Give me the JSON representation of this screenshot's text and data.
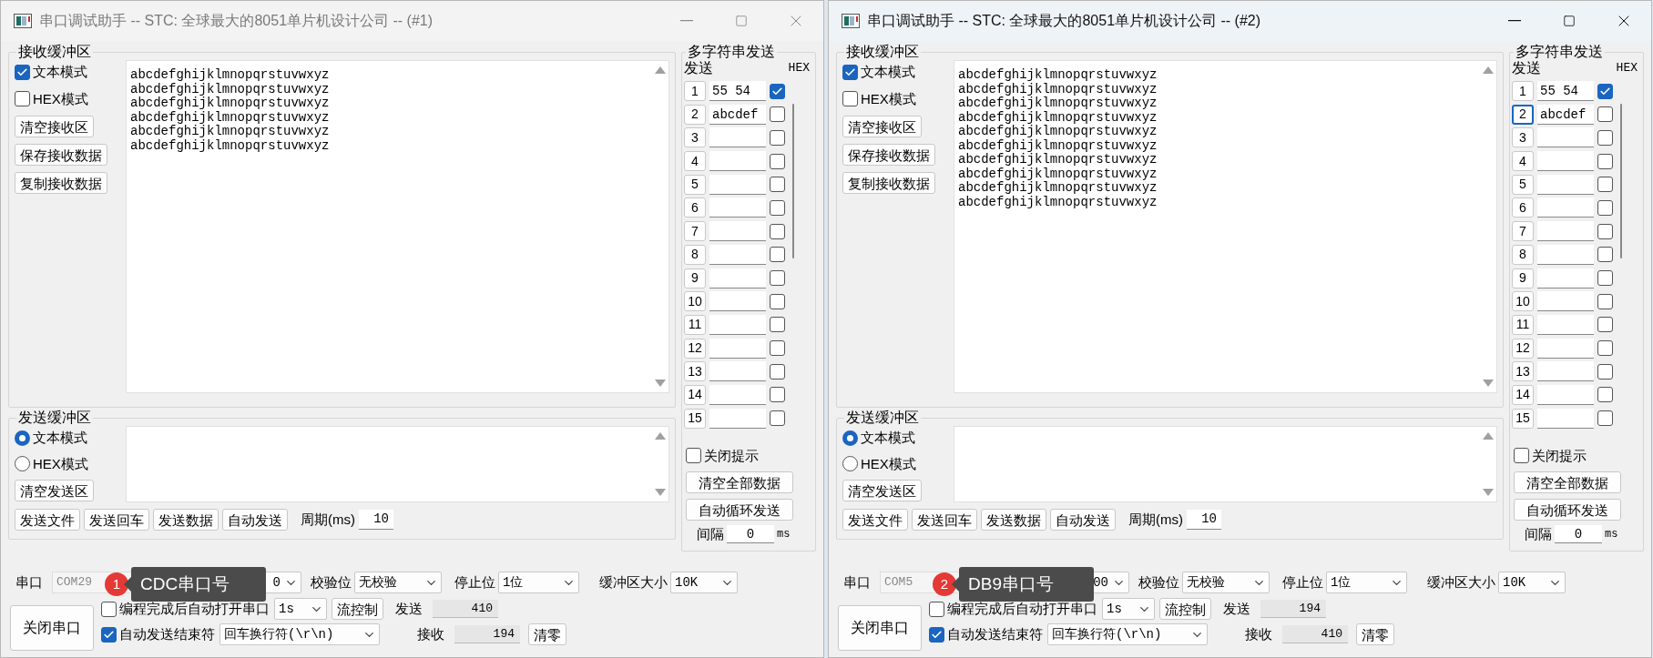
{
  "windows": [
    {
      "title": "串口调试助手 -- STC: 全球最大的8051单片机设计公司 -- (#1)",
      "active": false,
      "receive": {
        "label": "接收缓冲区",
        "modes": [
          {
            "label": "文本模式",
            "checked": true
          },
          {
            "label": "HEX模式",
            "checked": false
          }
        ],
        "buttons": [
          "清空接收区",
          "保存接收数据",
          "复制接收数据"
        ],
        "lines": [
          "abcdefghijklmnopqrstuvwxyz",
          "abcdefghijklmnopqrstuvwxyz",
          "abcdefghijklmnopqrstuvwxyz",
          "abcdefghijklmnopqrstuvwxyz",
          "abcdefghijklmnopqrstuvwxyz",
          "abcdefghijklmnopqrstuvwxyz"
        ]
      },
      "send": {
        "label": "发送缓冲区",
        "modes": [
          {
            "label": "文本模式",
            "selected": true
          },
          {
            "label": "HEX模式",
            "selected": false
          }
        ],
        "clear_button": "清空发送区",
        "buttons": [
          "发送文件",
          "发送回车",
          "发送数据",
          "自动发送"
        ],
        "period_label": "周期(ms)",
        "period": "10"
      },
      "multi_send": {
        "label": "多字符串发送",
        "send_header": "发送",
        "hex_header": "HEX",
        "rows": [
          {
            "number": "1",
            "value": "55 54",
            "hex": true,
            "focused": false
          },
          {
            "number": "2",
            "value": "abcdef",
            "hex": false,
            "focused": false
          },
          {
            "number": "3",
            "hex": false,
            "focused": false
          },
          {
            "number": "4",
            "hex": false,
            "focused": false
          },
          {
            "number": "5",
            "hex": false,
            "focused": false
          },
          {
            "number": "6",
            "hex": false,
            "focused": false
          },
          {
            "number": "7",
            "hex": false,
            "focused": false
          },
          {
            "number": "8",
            "hex": false,
            "focused": false
          },
          {
            "number": "9",
            "hex": false,
            "focused": false
          },
          {
            "number": "10",
            "hex": false,
            "focused": false
          },
          {
            "number": "11",
            "hex": false,
            "focused": false
          },
          {
            "number": "12",
            "hex": false,
            "focused": false
          },
          {
            "number": "13",
            "hex": false,
            "focused": false
          },
          {
            "number": "14",
            "hex": false,
            "focused": false
          },
          {
            "number": "15",
            "hex": false,
            "focused": false
          }
        ],
        "close_hint": {
          "label": "关闭提示",
          "checked": false
        },
        "buttons": [
          "清空全部数据",
          "自动循环发送"
        ],
        "interval_label": "间隔",
        "interval": "0",
        "interval_unit": "ms"
      },
      "port_bar": {
        "port_label": "串口",
        "port": "COM29",
        "baud": "0",
        "parity_label": "校验位",
        "parity": "无校验",
        "stop_label": "停止位",
        "stop": "1位",
        "buffer_label": "缓冲区大小",
        "buffer": "10K",
        "close_button": "关闭串口",
        "auto_open": {
          "label": "编程完成后自动打开串口",
          "checked": false
        },
        "auto_open_delay": "1s",
        "flow_button": "流控制",
        "auto_end": {
          "label": "自动发送结束符",
          "checked": true
        },
        "end_char": "回车换行符(\\r\\n)",
        "sent_label": "发送",
        "sent": "410",
        "received_label": "接收",
        "received": "194",
        "zero_button": "清零"
      },
      "tooltip": {
        "badge": "1",
        "text": "CDC串口号"
      }
    },
    {
      "title": "串口调试助手 -- STC: 全球最大的8051单片机设计公司 -- (#2)",
      "active": true,
      "receive": {
        "label": "接收缓冲区",
        "modes": [
          {
            "label": "文本模式",
            "checked": true
          },
          {
            "label": "HEX模式",
            "checked": false
          }
        ],
        "buttons": [
          "清空接收区",
          "保存接收数据",
          "复制接收数据"
        ],
        "lines": [
          "abcdefghijklmnopqrstuvwxyz",
          "abcdefghijklmnopqrstuvwxyz",
          "abcdefghijklmnopqrstuvwxyz",
          "abcdefghijklmnopqrstuvwxyz",
          "abcdefghijklmnopqrstuvwxyz",
          "abcdefghijklmnopqrstuvwxyz",
          "abcdefghijklmnopqrstuvwxyz",
          "abcdefghijklmnopqrstuvwxyz",
          "abcdefghijklmnopqrstuvwxyz",
          "abcdefghijklmnopqrstuvwxyz"
        ]
      },
      "send": {
        "label": "发送缓冲区",
        "modes": [
          {
            "label": "文本模式",
            "selected": true
          },
          {
            "label": "HEX模式",
            "selected": false
          }
        ],
        "clear_button": "清空发送区",
        "buttons": [
          "发送文件",
          "发送回车",
          "发送数据",
          "自动发送"
        ],
        "period_label": "周期(ms)",
        "period": "10"
      },
      "multi_send": {
        "label": "多字符串发送",
        "send_header": "发送",
        "hex_header": "HEX",
        "rows": [
          {
            "number": "1",
            "value": "55 54",
            "hex": true,
            "focused": false
          },
          {
            "number": "2",
            "value": "abcdef",
            "hex": false,
            "focused": true
          },
          {
            "number": "3",
            "hex": false,
            "focused": false
          },
          {
            "number": "4",
            "hex": false,
            "focused": false
          },
          {
            "number": "5",
            "hex": false,
            "focused": false
          },
          {
            "number": "6",
            "hex": false,
            "focused": false
          },
          {
            "number": "7",
            "hex": false,
            "focused": false
          },
          {
            "number": "8",
            "hex": false,
            "focused": false
          },
          {
            "number": "9",
            "hex": false,
            "focused": false
          },
          {
            "number": "10",
            "hex": false,
            "focused": false
          },
          {
            "number": "11",
            "hex": false,
            "focused": false
          },
          {
            "number": "12",
            "hex": false,
            "focused": false
          },
          {
            "number": "13",
            "hex": false,
            "focused": false
          },
          {
            "number": "14",
            "hex": false,
            "focused": false
          },
          {
            "number": "15",
            "hex": false,
            "focused": false
          }
        ],
        "close_hint": {
          "label": "关闭提示",
          "checked": false
        },
        "buttons": [
          "清空全部数据",
          "自动循环发送"
        ],
        "interval_label": "间隔",
        "interval": "0",
        "interval_unit": "ms"
      },
      "port_bar": {
        "port_label": "串口",
        "port": "COM5",
        "baud": "00",
        "parity_label": "校验位",
        "parity": "无校验",
        "stop_label": "停止位",
        "stop": "1位",
        "buffer_label": "缓冲区大小",
        "buffer": "10K",
        "close_button": "关闭串口",
        "auto_open": {
          "label": "编程完成后自动打开串口",
          "checked": false
        },
        "auto_open_delay": "1s",
        "flow_button": "流控制",
        "auto_end": {
          "label": "自动发送结束符",
          "checked": true
        },
        "end_char": "回车换行符(\\r\\n)",
        "sent_label": "发送",
        "sent": "194",
        "received_label": "接收",
        "received": "410",
        "zero_button": "清零"
      },
      "tooltip": {
        "badge": "2",
        "text": "DB9串口号"
      }
    }
  ]
}
